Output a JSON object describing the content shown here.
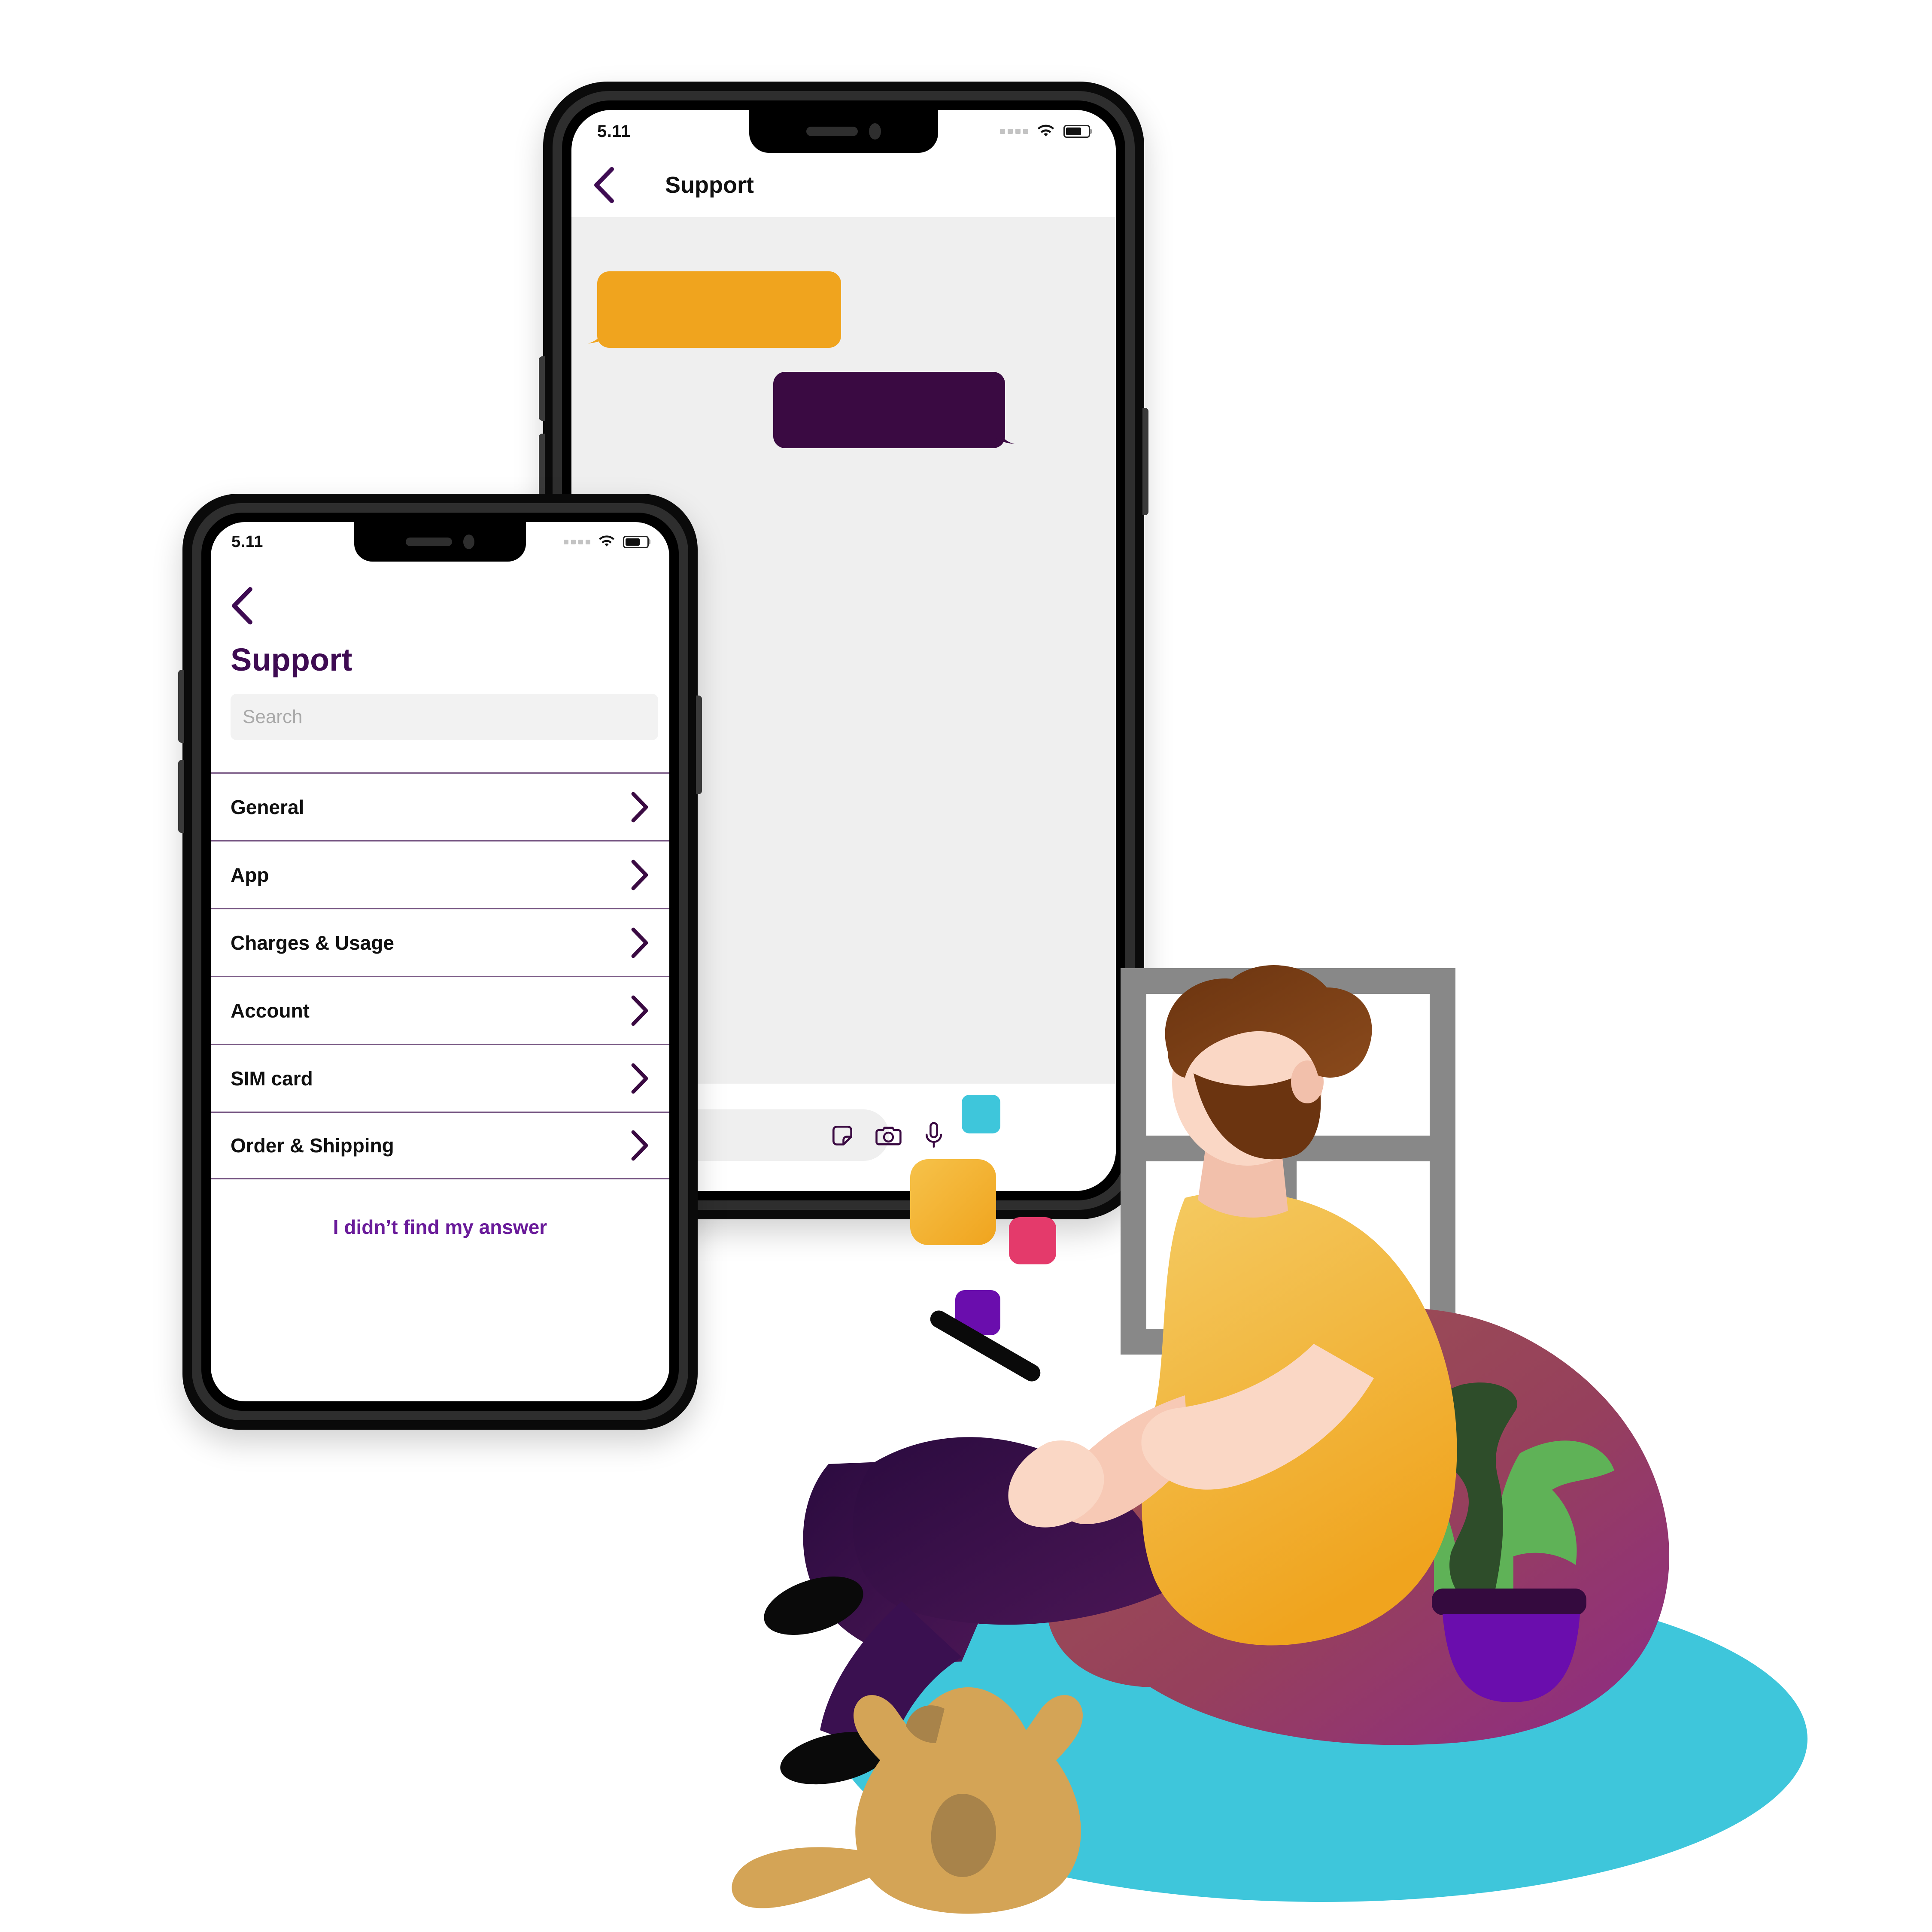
{
  "back_phone": {
    "status": {
      "time": "5.11",
      "signal_icon": "signal-dots-icon",
      "wifi_icon": "wifi-icon",
      "battery_icon": "battery-icon",
      "battery_level": 65
    },
    "nav": {
      "back_icon": "chevron-left-icon",
      "title": "Support"
    },
    "chat": {
      "messages": [
        {
          "sender": "agent",
          "side": "left",
          "color": "#F0A41E",
          "text": ""
        },
        {
          "sender": "user",
          "side": "right",
          "color": "#3A0A42",
          "text": ""
        }
      ],
      "composer": {
        "input_placeholder": "",
        "icons": [
          "sticker-icon",
          "camera-icon",
          "microphone-icon"
        ]
      }
    }
  },
  "front_phone": {
    "status": {
      "time": "5.11",
      "signal_icon": "signal-dots-icon",
      "wifi_icon": "wifi-icon",
      "battery_icon": "battery-icon",
      "battery_level": 65
    },
    "nav": {
      "back_icon": "chevron-left-icon"
    },
    "title": "Support",
    "search": {
      "placeholder": "Search",
      "value": ""
    },
    "list": [
      {
        "label": "General",
        "chevron": "chevron-right-icon"
      },
      {
        "label": "App",
        "chevron": "chevron-right-icon"
      },
      {
        "label": "Charges & Usage",
        "chevron": "chevron-right-icon"
      },
      {
        "label": "Account",
        "chevron": "chevron-right-icon"
      },
      {
        "label": "SIM card",
        "chevron": "chevron-right-icon"
      },
      {
        "label": "Order & Shipping",
        "chevron": "chevron-right-icon"
      }
    ],
    "footer_link": "I didn’t find my answer"
  },
  "illustration": {
    "name": "person-on-beanbag-with-phone",
    "elements": [
      "window-frame",
      "rug-ellipse",
      "beanbag-chair",
      "person",
      "cat",
      "potted-plant",
      "floating-squares"
    ],
    "squares": [
      {
        "name": "cyan-square",
        "color": "#3EC6DB"
      },
      {
        "name": "yellow-square",
        "color": "#F5B829"
      },
      {
        "name": "pink-square",
        "color": "#E43A6B"
      },
      {
        "name": "purple-square",
        "color": "#6A0DAD"
      }
    ]
  },
  "colors": {
    "brand_purple": "#3E0B52",
    "link_purple": "#6A1B9A",
    "accent_orange": "#F0A41E",
    "bubble_dark": "#3A0A42",
    "chat_bg": "#EFEFEF",
    "search_bg": "#F2F2F2",
    "divider": "#7a5a86",
    "rug_cyan": "#3EC6DB",
    "window_gray": "#888888"
  }
}
